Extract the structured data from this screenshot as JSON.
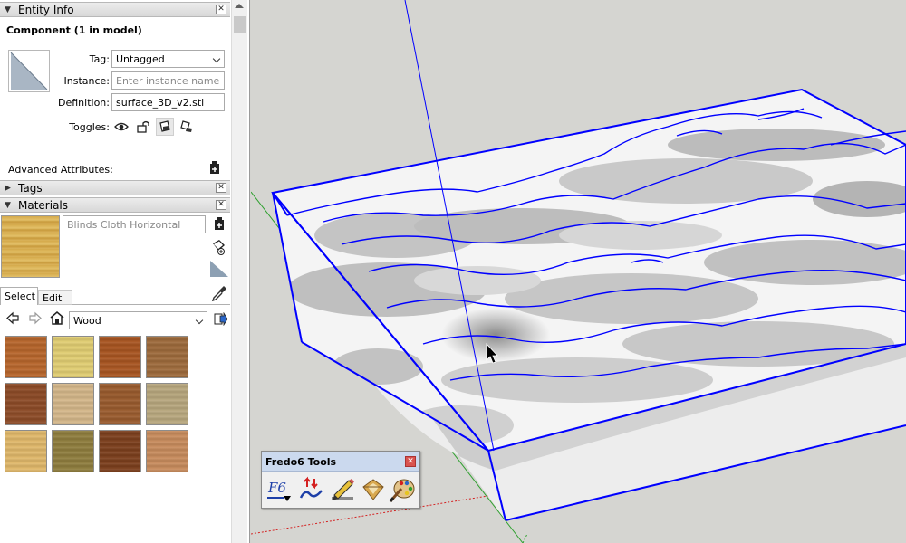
{
  "entity_info": {
    "title": "Entity Info",
    "component_heading": "Component (1 in model)",
    "tag_label": "Tag:",
    "tag_value": "Untagged",
    "instance_label": "Instance:",
    "instance_placeholder": "Enter instance name",
    "definition_label": "Definition:",
    "definition_value": "surface_3D_v2.stl",
    "toggles_label": "Toggles:",
    "advanced_label": "Advanced Attributes:"
  },
  "tags_panel": {
    "title": "Tags"
  },
  "materials": {
    "title": "Materials",
    "current_material": "Blinds Cloth Horizontal",
    "tab_select": "Select",
    "tab_edit": "Edit",
    "library_value": "Wood",
    "swatch_colors": [
      "#b8652a",
      "#e3cf72",
      "#a9541f",
      "#9e6a3a",
      "#8d4a25",
      "#d6b88a",
      "#9a5a2c",
      "#b9a87e",
      "#e2b96a",
      "#8f7d3c",
      "#7c3e1b",
      "#c98c5c"
    ]
  },
  "fredo_toolbar": {
    "title": "Fredo6 Tools"
  },
  "colors": {
    "selection_blue": "#0000ff",
    "axis_green": "#2ea02e",
    "axis_red": "#d42020"
  }
}
